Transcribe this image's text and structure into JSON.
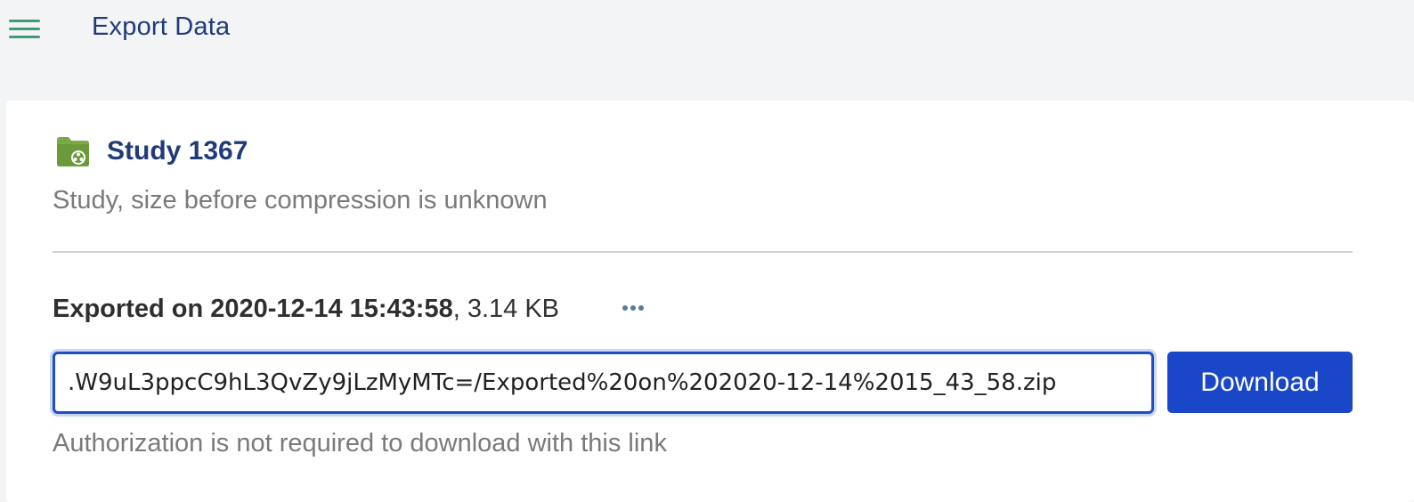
{
  "header": {
    "title": "Export Data",
    "menu_icon": "hamburger-menu-icon",
    "menu_color": "#3f9b76"
  },
  "study": {
    "icon": "study-folder-icon",
    "icon_color": "#6a9a3a",
    "name": "Study 1367",
    "description": "Study, size before compression is unknown"
  },
  "export": {
    "prefix": "Exported on ",
    "datetime": "2020-12-14 15:43:58",
    "size": ", 3.14 KB",
    "more_icon": "ellipsis-icon",
    "link_value": "‪.W9uL3ppcC9hL3QvZy9jLzMyMTc=/Exported%20on%202020-12-14%2015_43_58.zip‬",
    "download_label": "Download",
    "note": "Authorization is not required to download with this link"
  },
  "colors": {
    "accent": "#1a47c8",
    "title": "#1f3b7a",
    "muted_text": "#7a7a7a",
    "background": "#f3f4f6"
  }
}
